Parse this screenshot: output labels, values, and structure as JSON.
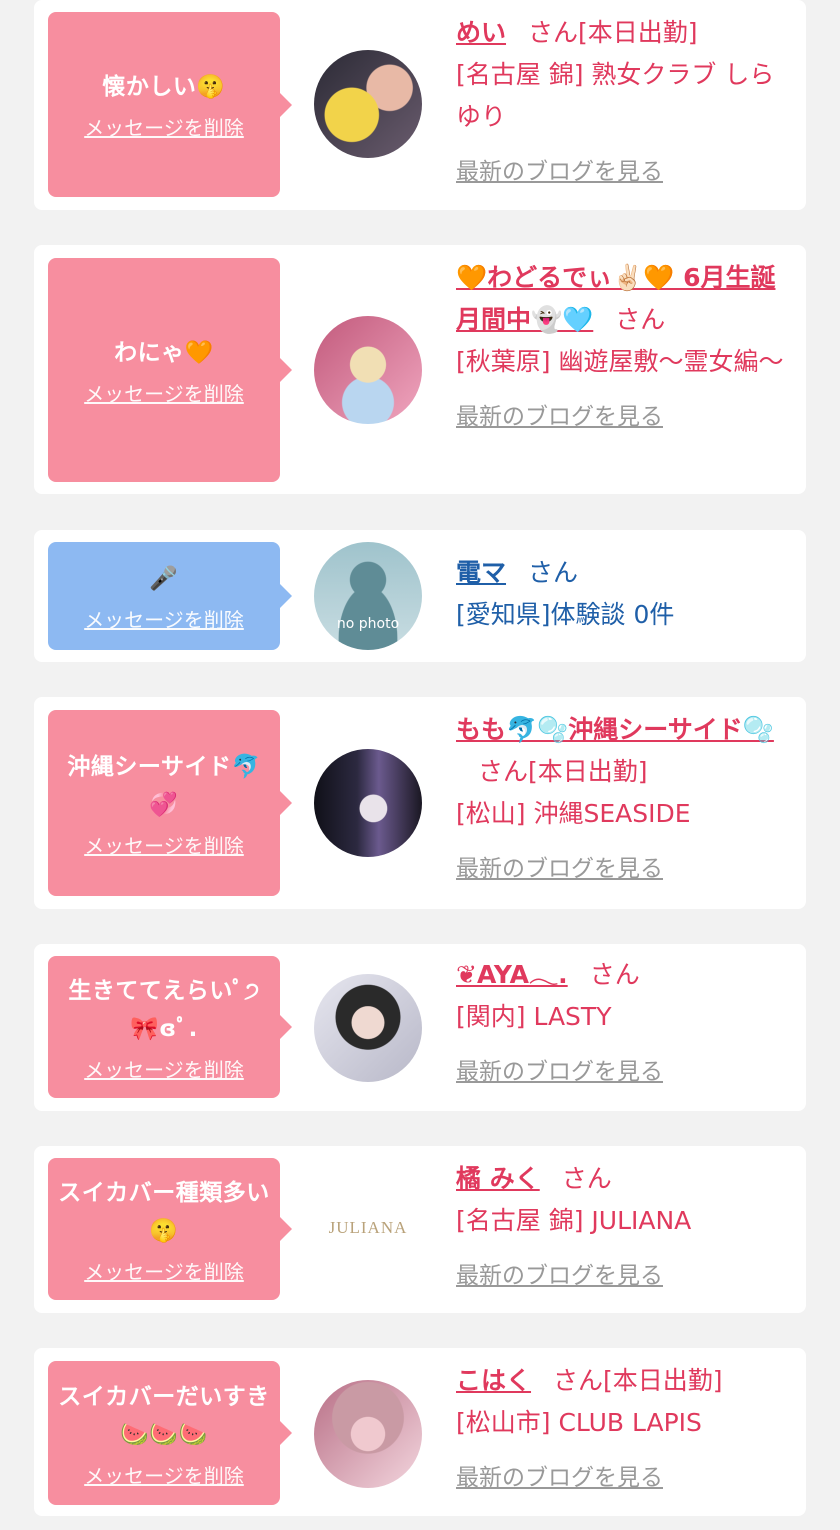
{
  "cards": [
    {
      "message": "懐かしい🤫",
      "delete_label": "メッセージを削除",
      "name": "めい",
      "suffix": "さん",
      "status": "[本日出勤]",
      "store": "[名古屋 錦] 熟女クラブ しらゆり",
      "blog_label": "最新のブログを見る",
      "bubble_color": "#f78e9f"
    },
    {
      "message": "わにゃ🧡",
      "delete_label": "メッセージを削除",
      "name": "🧡わどるでぃ✌🏻🧡 6月生誕月間中👻🩵",
      "suffix": "さん",
      "status": "",
      "store": "[秋葉原] 幽遊屋敷〜霊女編〜",
      "blog_label": "最新のブログを見る",
      "bubble_color": "#f78e9f"
    },
    {
      "message": "🎤",
      "delete_label": "メッセージを削除",
      "name": "電マ",
      "suffix": "さん",
      "status": "",
      "store": "[愛知県]体験談 0件",
      "blog_label": "",
      "bubble_color": "#8db9f2",
      "avatar_text": "no photo"
    },
    {
      "message": "沖縄シーサイド🐬💞",
      "delete_label": "メッセージを削除",
      "name": "もも🐬🫧沖縄シーサイド🫧",
      "suffix": "さん",
      "status": "[本日出勤]",
      "store": "[松山] 沖縄SEASIDE",
      "blog_label": "最新のブログを見る",
      "bubble_color": "#f78e9f"
    },
    {
      "message": "生きててえらいﾟ੭ 🎀ɞﾟ.",
      "delete_label": "メッセージを削除",
      "name": "❦AYA𓂃.",
      "suffix": "さん",
      "status": "",
      "store": "[関内] LASTY",
      "blog_label": "最新のブログを見る",
      "bubble_color": "#f78e9f"
    },
    {
      "message": "スイカバー種類多い🤫",
      "delete_label": "メッセージを削除",
      "name": "橘 みく",
      "suffix": "さん",
      "status": "",
      "store": "[名古屋 錦] JULIANA",
      "blog_label": "最新のブログを見る",
      "bubble_color": "#f78e9f",
      "avatar_text": "JULIANA"
    },
    {
      "message": "スイカバーだいすき🍉🍉🍉",
      "delete_label": "メッセージを削除",
      "name": "こはく",
      "suffix": "さん",
      "status": "[本日出勤]",
      "store": "[松山市] CLUB LAPIS",
      "blog_label": "最新のブログを見る",
      "bubble_color": "#f78e9f"
    }
  ]
}
